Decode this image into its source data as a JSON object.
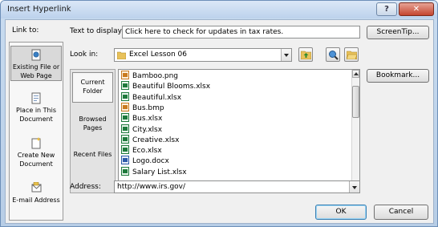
{
  "window": {
    "title": "Insert Hyperlink",
    "help_glyph": "?",
    "close_glyph": "✕"
  },
  "link_to": {
    "label_pre": "Link to:",
    "items": [
      {
        "label": "Existing File or Web Page",
        "icon": "globe-page-icon",
        "selected": true
      },
      {
        "label": "Place in This Document",
        "icon": "document-icon",
        "selected": false
      },
      {
        "label": "Create New Document",
        "icon": "new-document-icon",
        "selected": false
      },
      {
        "label": "E-mail Address",
        "icon": "email-icon",
        "selected": false
      }
    ]
  },
  "text_to_display": {
    "label": "Text to display:",
    "value": "Click here to check for updates in tax rates."
  },
  "screentip_button": "ScreenTip...",
  "look_in": {
    "label": "Look in:",
    "value": "Excel Lesson 06",
    "folder_icon": "folder-icon"
  },
  "toolbar": {
    "up_folder_icon": "up-folder-icon",
    "browse_web_icon": "browse-web-icon",
    "browse_file_icon": "browse-file-icon"
  },
  "bookmark_button": "Bookmark...",
  "browse_panel": {
    "items": [
      {
        "label": "Current Folder",
        "selected": true
      },
      {
        "label": "Browsed Pages",
        "selected": false
      },
      {
        "label": "Recent Files",
        "selected": false
      }
    ]
  },
  "files": [
    {
      "name": "Bamboo.png",
      "icon": "image-file-icon"
    },
    {
      "name": "Beautiful Blooms.xlsx",
      "icon": "excel-file-icon"
    },
    {
      "name": "Beautiful.xlsx",
      "icon": "excel-file-icon"
    },
    {
      "name": "Bus.bmp",
      "icon": "image-file-icon"
    },
    {
      "name": "Bus.xlsx",
      "icon": "excel-file-icon"
    },
    {
      "name": "City.xlsx",
      "icon": "excel-file-icon"
    },
    {
      "name": "Creative.xlsx",
      "icon": "excel-file-icon"
    },
    {
      "name": "Eco.xlsx",
      "icon": "excel-file-icon"
    },
    {
      "name": "Logo.docx",
      "icon": "word-file-icon"
    },
    {
      "name": "Salary List.xlsx",
      "icon": "excel-file-icon"
    }
  ],
  "address": {
    "label": "Address:",
    "value": "http://www.irs.gov/"
  },
  "ok_button": "OK",
  "cancel_button": "Cancel",
  "colors": {
    "titlebar": "#bcd2ec",
    "dialog_bg": "#f0f0f0",
    "close_red": "#c4452f",
    "selected_bg": "#d9d9d9"
  }
}
